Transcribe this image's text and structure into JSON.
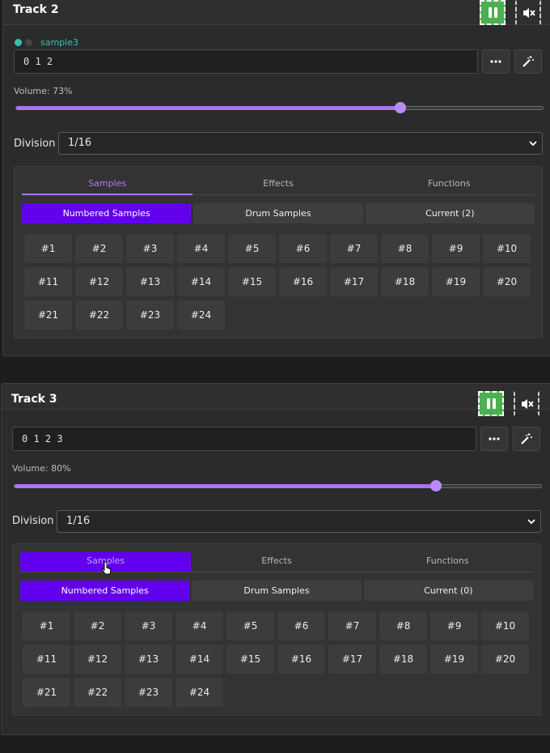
{
  "track2": {
    "title": "Track 2",
    "sample_name": "sample3",
    "pattern": "0 1 2",
    "volume_label": "Volume: 73%",
    "volume_fraction": 0.73,
    "division_label": "Division",
    "division_value": "1/16",
    "tabs": [
      "Samples",
      "Effects",
      "Functions"
    ],
    "subtabs": [
      "Numbered Samples",
      "Drum Samples",
      "Current (2)"
    ],
    "samples": [
      "#1",
      "#2",
      "#3",
      "#4",
      "#5",
      "#6",
      "#7",
      "#8",
      "#9",
      "#10",
      "#11",
      "#12",
      "#13",
      "#14",
      "#15",
      "#16",
      "#17",
      "#18",
      "#19",
      "#20",
      "#21",
      "#22",
      "#23",
      "#24"
    ]
  },
  "track3": {
    "title": "Track 3",
    "pattern": "0 1 2 3",
    "volume_label": "Volume: 80%",
    "volume_fraction": 0.8,
    "division_label": "Division",
    "division_value": "1/16",
    "tabs": [
      "Samples",
      "Effects",
      "Functions"
    ],
    "subtabs": [
      "Numbered Samples",
      "Drum Samples",
      "Current (0)"
    ],
    "samples": [
      "#1",
      "#2",
      "#3",
      "#4",
      "#5",
      "#6",
      "#7",
      "#8",
      "#9",
      "#10",
      "#11",
      "#12",
      "#13",
      "#14",
      "#15",
      "#16",
      "#17",
      "#18",
      "#19",
      "#20",
      "#21",
      "#22",
      "#23",
      "#24"
    ]
  },
  "colors": {
    "accent": "#a875f0",
    "active_fill": "#6200ee",
    "play_green": "#4caf50",
    "indicator_teal": "#2ec4b6"
  },
  "icons": {
    "pause": "pause-icon",
    "mute": "volume-mute-icon",
    "more": "more-horizontal-icon",
    "magic": "magic-wand-icon",
    "chevron": "chevron-down-icon"
  }
}
